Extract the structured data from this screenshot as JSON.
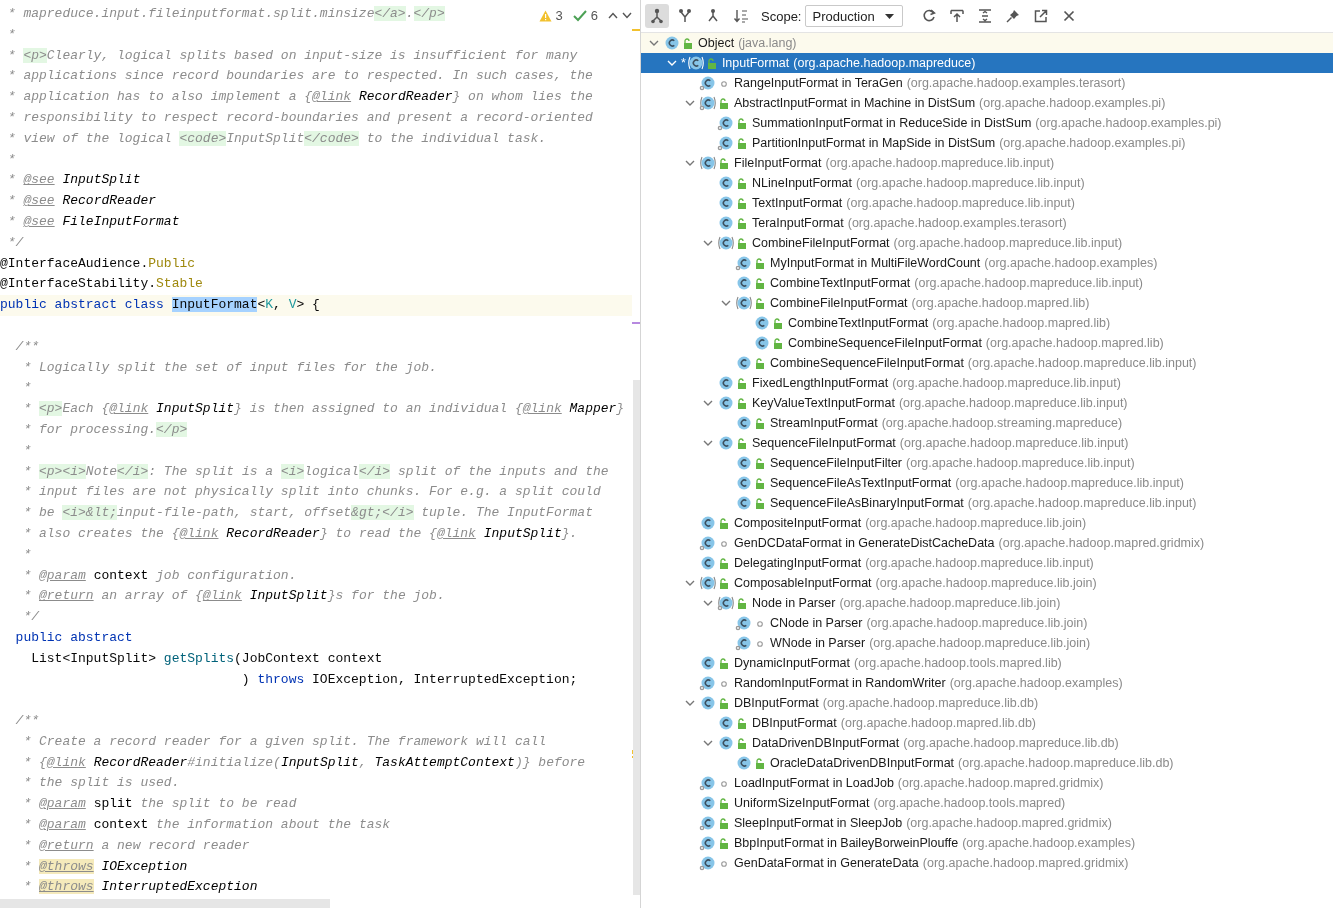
{
  "editor": {
    "inspections": {
      "warnings": "3",
      "checks": "6"
    },
    "lines": [
      {
        "kind": "code",
        "tokens": [
          {
            "kind": "c",
            "text": " * mapreduce.input.fileinputformat.split.minsize"
          },
          {
            "kind": "t",
            "text": "</a>"
          },
          {
            "kind": "c",
            "text": "."
          },
          {
            "kind": "t",
            "text": "</p>"
          }
        ]
      },
      {
        "kind": "code",
        "tokens": [
          {
            "kind": "c",
            "text": " *"
          }
        ]
      },
      {
        "kind": "code",
        "tokens": [
          {
            "kind": "c",
            "text": " * "
          },
          {
            "kind": "t",
            "text": "<p>"
          },
          {
            "kind": "c",
            "text": "Clearly, logical splits based on input-size is insufficient for many"
          }
        ]
      },
      {
        "kind": "code",
        "tokens": [
          {
            "kind": "c",
            "text": " * applications since record boundaries are to respected. In such cases, the"
          }
        ]
      },
      {
        "kind": "code",
        "tokens": [
          {
            "kind": "c",
            "text": " * application has to also implement a {"
          },
          {
            "kind": "d",
            "text": "@link"
          },
          {
            "kind": "r",
            "text": " RecordReader"
          },
          {
            "kind": "c",
            "text": "} on whom lies the"
          }
        ]
      },
      {
        "kind": "code",
        "tokens": [
          {
            "kind": "c",
            "text": " * responsibility to respect record-boundaries and present a record-oriented"
          }
        ]
      },
      {
        "kind": "code",
        "tokens": [
          {
            "kind": "c",
            "text": " * view of the logical "
          },
          {
            "kind": "t",
            "text": "<code>"
          },
          {
            "kind": "c",
            "text": "InputSplit"
          },
          {
            "kind": "t",
            "text": "</code>"
          },
          {
            "kind": "c",
            "text": " to the individual task."
          }
        ]
      },
      {
        "kind": "code",
        "tokens": [
          {
            "kind": "c",
            "text": " *"
          }
        ]
      },
      {
        "kind": "code",
        "tokens": [
          {
            "kind": "c",
            "text": " * "
          },
          {
            "kind": "d",
            "text": "@see"
          },
          {
            "kind": "r",
            "text": " InputSplit"
          }
        ]
      },
      {
        "kind": "code",
        "tokens": [
          {
            "kind": "c",
            "text": " * "
          },
          {
            "kind": "d",
            "text": "@see"
          },
          {
            "kind": "r",
            "text": " RecordReader"
          }
        ]
      },
      {
        "kind": "code",
        "tokens": [
          {
            "kind": "c",
            "text": " * "
          },
          {
            "kind": "d",
            "text": "@see"
          },
          {
            "kind": "r",
            "text": " FileInputFormat"
          }
        ]
      },
      {
        "kind": "code",
        "tokens": [
          {
            "kind": "c",
            "text": " */"
          }
        ]
      },
      {
        "kind": "code",
        "tokens": [
          {
            "kind": "p",
            "text": "@InterfaceAudience."
          },
          {
            "kind": "a",
            "text": "Public"
          }
        ]
      },
      {
        "kind": "code",
        "tokens": [
          {
            "kind": "p",
            "text": "@InterfaceStability."
          },
          {
            "kind": "a",
            "text": "Stable"
          }
        ]
      },
      {
        "kind": "current",
        "tokens": [
          {
            "kind": "k",
            "text": "public abstract class "
          },
          {
            "kind": "h",
            "text": "InputFormat"
          },
          {
            "kind": "p",
            "text": "<"
          },
          {
            "kind": "ty",
            "text": "K"
          },
          {
            "kind": "p",
            "text": ", "
          },
          {
            "kind": "ty",
            "text": "V"
          },
          {
            "kind": "p",
            "text": "> {"
          }
        ]
      },
      {
        "kind": "blank"
      },
      {
        "kind": "code",
        "tokens": [
          {
            "kind": "c",
            "text": "  /**"
          }
        ]
      },
      {
        "kind": "code",
        "tokens": [
          {
            "kind": "c",
            "text": "   * Logically split the set of input files for the job."
          }
        ]
      },
      {
        "kind": "code",
        "tokens": [
          {
            "kind": "c",
            "text": "   *"
          }
        ]
      },
      {
        "kind": "code",
        "tokens": [
          {
            "kind": "c",
            "text": "   * "
          },
          {
            "kind": "t",
            "text": "<p>"
          },
          {
            "kind": "c",
            "text": "Each {"
          },
          {
            "kind": "d",
            "text": "@link"
          },
          {
            "kind": "r",
            "text": " InputSplit"
          },
          {
            "kind": "c",
            "text": "} is then assigned to an individual {"
          },
          {
            "kind": "d",
            "text": "@link"
          },
          {
            "kind": "r",
            "text": " Mapper"
          },
          {
            "kind": "c",
            "text": "}"
          }
        ]
      },
      {
        "kind": "code",
        "tokens": [
          {
            "kind": "c",
            "text": "   * for processing."
          },
          {
            "kind": "t",
            "text": "</p>"
          }
        ]
      },
      {
        "kind": "code",
        "tokens": [
          {
            "kind": "c",
            "text": "   *"
          }
        ]
      },
      {
        "kind": "code",
        "tokens": [
          {
            "kind": "c",
            "text": "   * "
          },
          {
            "kind": "t",
            "text": "<p><i>"
          },
          {
            "kind": "c",
            "text": "Note"
          },
          {
            "kind": "t",
            "text": "</i>"
          },
          {
            "kind": "c",
            "text": ": The split is a "
          },
          {
            "kind": "t",
            "text": "<i>"
          },
          {
            "kind": "c",
            "text": "logical"
          },
          {
            "kind": "t",
            "text": "</i>"
          },
          {
            "kind": "c",
            "text": " split of the inputs and the"
          }
        ]
      },
      {
        "kind": "code",
        "tokens": [
          {
            "kind": "c",
            "text": "   * input files are not physically split into chunks. For e.g. a split could"
          }
        ]
      },
      {
        "kind": "code",
        "tokens": [
          {
            "kind": "c",
            "text": "   * be "
          },
          {
            "kind": "t",
            "text": "<i>&lt;"
          },
          {
            "kind": "c",
            "text": "input-file-path, start, offset"
          },
          {
            "kind": "t",
            "text": "&gt;</i>"
          },
          {
            "kind": "c",
            "text": " tuple. The InputFormat"
          }
        ]
      },
      {
        "kind": "code",
        "tokens": [
          {
            "kind": "c",
            "text": "   * also creates the {"
          },
          {
            "kind": "d",
            "text": "@link"
          },
          {
            "kind": "r",
            "text": " RecordReader"
          },
          {
            "kind": "c",
            "text": "} to read the {"
          },
          {
            "kind": "d",
            "text": "@link"
          },
          {
            "kind": "r",
            "text": " InputSplit"
          },
          {
            "kind": "c",
            "text": "}."
          }
        ]
      },
      {
        "kind": "code",
        "tokens": [
          {
            "kind": "c",
            "text": "   *"
          }
        ]
      },
      {
        "kind": "code",
        "tokens": [
          {
            "kind": "c",
            "text": "   * "
          },
          {
            "kind": "d",
            "text": "@param"
          },
          {
            "kind": "n",
            "text": " context"
          },
          {
            "kind": "c",
            "text": " job configuration."
          }
        ]
      },
      {
        "kind": "code",
        "tokens": [
          {
            "kind": "c",
            "text": "   * "
          },
          {
            "kind": "d",
            "text": "@return"
          },
          {
            "kind": "c",
            "text": " an array of {"
          },
          {
            "kind": "d",
            "text": "@link"
          },
          {
            "kind": "r",
            "text": " InputSplit"
          },
          {
            "kind": "c",
            "text": "}s for the job."
          }
        ]
      },
      {
        "kind": "code",
        "tokens": [
          {
            "kind": "c",
            "text": "   */"
          }
        ]
      },
      {
        "kind": "code",
        "tokens": [
          {
            "kind": "k",
            "text": "  public abstract"
          }
        ]
      },
      {
        "kind": "code",
        "tokens": [
          {
            "kind": "p",
            "text": "    List<InputSplit> "
          },
          {
            "kind": "m",
            "text": "getSplits"
          },
          {
            "kind": "p",
            "text": "(JobContext context"
          }
        ]
      },
      {
        "kind": "code",
        "tokens": [
          {
            "kind": "p",
            "text": "                               ) "
          },
          {
            "kind": "k",
            "text": "throws"
          },
          {
            "kind": "p",
            "text": " IOException, InterruptedException;"
          }
        ]
      },
      {
        "kind": "blank"
      },
      {
        "kind": "code",
        "tokens": [
          {
            "kind": "c",
            "text": "  /**"
          }
        ]
      },
      {
        "kind": "code",
        "tokens": [
          {
            "kind": "c",
            "text": "   * Create a record reader for a given split. The framework will call"
          }
        ]
      },
      {
        "kind": "code",
        "tokens": [
          {
            "kind": "c",
            "text": "   * {"
          },
          {
            "kind": "d",
            "text": "@link"
          },
          {
            "kind": "r",
            "text": " RecordReader"
          },
          {
            "kind": "c",
            "text": "#initialize("
          },
          {
            "kind": "r",
            "text": "InputSplit"
          },
          {
            "kind": "c",
            "text": ", "
          },
          {
            "kind": "r",
            "text": "TaskAttemptContext"
          },
          {
            "kind": "c",
            "text": ")} before"
          }
        ]
      },
      {
        "kind": "code",
        "tokens": [
          {
            "kind": "c",
            "text": "   * the split is used."
          }
        ]
      },
      {
        "kind": "code",
        "tokens": [
          {
            "kind": "c",
            "text": "   * "
          },
          {
            "kind": "d",
            "text": "@param"
          },
          {
            "kind": "n",
            "text": " split"
          },
          {
            "kind": "c",
            "text": " the split to be read"
          }
        ]
      },
      {
        "kind": "code",
        "tokens": [
          {
            "kind": "c",
            "text": "   * "
          },
          {
            "kind": "d",
            "text": "@param"
          },
          {
            "kind": "n",
            "text": " context"
          },
          {
            "kind": "c",
            "text": " the information about the task"
          }
        ]
      },
      {
        "kind": "code",
        "tokens": [
          {
            "kind": "c",
            "text": "   * "
          },
          {
            "kind": "d",
            "text": "@return"
          },
          {
            "kind": "c",
            "text": " a new record reader"
          }
        ]
      },
      {
        "kind": "code",
        "tokens": [
          {
            "kind": "c",
            "text": "   * "
          },
          {
            "kind": "dh",
            "text": "@throws"
          },
          {
            "kind": "r",
            "text": " IOException"
          }
        ]
      },
      {
        "kind": "code",
        "tokens": [
          {
            "kind": "c",
            "text": "   * "
          },
          {
            "kind": "dh",
            "text": "@throws"
          },
          {
            "kind": "r",
            "text": " InterruptedException"
          }
        ]
      }
    ]
  },
  "toolbar": {
    "modes": [
      {
        "kind": "hierarchy",
        "selected": true
      },
      {
        "kind": "supertypes",
        "selected": false
      },
      {
        "kind": "subtypes",
        "selected": false
      },
      {
        "kind": "sort",
        "selected": false
      }
    ],
    "scope_label": "Scope:",
    "scope": "Production",
    "actions": [
      {
        "kind": "refresh"
      },
      {
        "kind": "export"
      },
      {
        "kind": "expand"
      },
      {
        "kind": "pin"
      },
      {
        "kind": "open"
      },
      {
        "kind": "close"
      }
    ]
  },
  "tree": [
    {
      "name": "Object",
      "package": "(java.lang)",
      "abstract": false,
      "public": true,
      "nested": false,
      "selected": false,
      "expanded": true,
      "children": [
        {
          "name": "InputFormat",
          "package": "(org.apache.hadoop.mapreduce)",
          "marker": "*",
          "abstract": true,
          "public": true,
          "nested": false,
          "selected": true,
          "expanded": true,
          "children": [
            {
              "name": "RangeInputFormat in TeraGen",
              "package": "(org.apache.hadoop.examples.terasort)",
              "abstract": false,
              "public": false,
              "nested": true,
              "selected": false
            },
            {
              "name": "AbstractInputFormat in Machine in DistSum",
              "package": "(org.apache.hadoop.examples.pi)",
              "abstract": true,
              "public": true,
              "nested": true,
              "selected": false,
              "expanded": true,
              "children": [
                {
                  "name": "SummationInputFormat in ReduceSide in DistSum",
                  "package": "(org.apache.hadoop.examples.pi)",
                  "abstract": false,
                  "public": true,
                  "nested": true,
                  "selected": false
                },
                {
                  "name": "PartitionInputFormat in MapSide in DistSum",
                  "package": "(org.apache.hadoop.examples.pi)",
                  "abstract": false,
                  "public": true,
                  "nested": true,
                  "selected": false
                }
              ]
            },
            {
              "name": "FileInputFormat",
              "package": "(org.apache.hadoop.mapreduce.lib.input)",
              "abstract": true,
              "public": true,
              "nested": false,
              "selected": false,
              "expanded": true,
              "children": [
                {
                  "name": "NLineInputFormat",
                  "package": "(org.apache.hadoop.mapreduce.lib.input)",
                  "abstract": false,
                  "public": true,
                  "nested": false,
                  "selected": false
                },
                {
                  "name": "TextInputFormat",
                  "package": "(org.apache.hadoop.mapreduce.lib.input)",
                  "abstract": false,
                  "public": true,
                  "nested": false,
                  "selected": false
                },
                {
                  "name": "TeraInputFormat",
                  "package": "(org.apache.hadoop.examples.terasort)",
                  "abstract": false,
                  "public": true,
                  "nested": false,
                  "selected": false
                },
                {
                  "name": "CombineFileInputFormat",
                  "package": "(org.apache.hadoop.mapreduce.lib.input)",
                  "abstract": true,
                  "public": true,
                  "nested": false,
                  "selected": false,
                  "expanded": true,
                  "children": [
                    {
                      "name": "MyInputFormat in MultiFileWordCount",
                      "package": "(org.apache.hadoop.examples)",
                      "abstract": false,
                      "public": true,
                      "nested": true,
                      "selected": false
                    },
                    {
                      "name": "CombineTextInputFormat",
                      "package": "(org.apache.hadoop.mapreduce.lib.input)",
                      "abstract": false,
                      "public": true,
                      "nested": false,
                      "selected": false
                    },
                    {
                      "name": "CombineFileInputFormat",
                      "package": "(org.apache.hadoop.mapred.lib)",
                      "abstract": true,
                      "public": true,
                      "nested": false,
                      "selected": false,
                      "expanded": true,
                      "children": [
                        {
                          "name": "CombineTextInputFormat",
                          "package": "(org.apache.hadoop.mapred.lib)",
                          "abstract": false,
                          "public": true,
                          "nested": false,
                          "selected": false
                        },
                        {
                          "name": "CombineSequenceFileInputFormat",
                          "package": "(org.apache.hadoop.mapred.lib)",
                          "abstract": false,
                          "public": true,
                          "nested": false,
                          "selected": false
                        }
                      ]
                    },
                    {
                      "name": "CombineSequenceFileInputFormat",
                      "package": "(org.apache.hadoop.mapreduce.lib.input)",
                      "abstract": false,
                      "public": true,
                      "nested": false,
                      "selected": false
                    }
                  ]
                },
                {
                  "name": "FixedLengthInputFormat",
                  "package": "(org.apache.hadoop.mapreduce.lib.input)",
                  "abstract": false,
                  "public": true,
                  "nested": false,
                  "selected": false
                },
                {
                  "name": "KeyValueTextInputFormat",
                  "package": "(org.apache.hadoop.mapreduce.lib.input)",
                  "abstract": false,
                  "public": true,
                  "nested": false,
                  "selected": false,
                  "expanded": true,
                  "children": [
                    {
                      "name": "StreamInputFormat",
                      "package": "(org.apache.hadoop.streaming.mapreduce)",
                      "abstract": false,
                      "public": true,
                      "nested": false,
                      "selected": false
                    }
                  ]
                },
                {
                  "name": "SequenceFileInputFormat",
                  "package": "(org.apache.hadoop.mapreduce.lib.input)",
                  "abstract": false,
                  "public": true,
                  "nested": false,
                  "selected": false,
                  "expanded": true,
                  "children": [
                    {
                      "name": "SequenceFileInputFilter",
                      "package": "(org.apache.hadoop.mapreduce.lib.input)",
                      "abstract": false,
                      "public": true,
                      "nested": false,
                      "selected": false
                    },
                    {
                      "name": "SequenceFileAsTextInputFormat",
                      "package": "(org.apache.hadoop.mapreduce.lib.input)",
                      "abstract": false,
                      "public": true,
                      "nested": false,
                      "selected": false
                    },
                    {
                      "name": "SequenceFileAsBinaryInputFormat",
                      "package": "(org.apache.hadoop.mapreduce.lib.input)",
                      "abstract": false,
                      "public": true,
                      "nested": false,
                      "selected": false
                    }
                  ]
                }
              ]
            },
            {
              "name": "CompositeInputFormat",
              "package": "(org.apache.hadoop.mapreduce.lib.join)",
              "abstract": false,
              "public": true,
              "nested": false,
              "selected": false
            },
            {
              "name": "GenDCDataFormat in GenerateDistCacheData",
              "package": "(org.apache.hadoop.mapred.gridmix)",
              "abstract": false,
              "public": false,
              "nested": true,
              "selected": false
            },
            {
              "name": "DelegatingInputFormat",
              "package": "(org.apache.hadoop.mapreduce.lib.input)",
              "abstract": false,
              "public": true,
              "nested": false,
              "selected": false
            },
            {
              "name": "ComposableInputFormat",
              "package": "(org.apache.hadoop.mapreduce.lib.join)",
              "abstract": true,
              "public": true,
              "nested": false,
              "selected": false,
              "expanded": true,
              "children": [
                {
                  "name": "Node in Parser",
                  "package": "(org.apache.hadoop.mapreduce.lib.join)",
                  "abstract": true,
                  "public": true,
                  "nested": true,
                  "selected": false,
                  "expanded": true,
                  "children": [
                    {
                      "name": "CNode in Parser",
                      "package": "(org.apache.hadoop.mapreduce.lib.join)",
                      "abstract": false,
                      "public": false,
                      "nested": true,
                      "selected": false
                    },
                    {
                      "name": "WNode in Parser",
                      "package": "(org.apache.hadoop.mapreduce.lib.join)",
                      "abstract": false,
                      "public": false,
                      "nested": true,
                      "selected": false
                    }
                  ]
                }
              ]
            },
            {
              "name": "DynamicInputFormat",
              "package": "(org.apache.hadoop.tools.mapred.lib)",
              "abstract": false,
              "public": true,
              "nested": false,
              "selected": false
            },
            {
              "name": "RandomInputFormat in RandomWriter",
              "package": "(org.apache.hadoop.examples)",
              "abstract": false,
              "public": false,
              "nested": true,
              "selected": false
            },
            {
              "name": "DBInputFormat",
              "package": "(org.apache.hadoop.mapreduce.lib.db)",
              "abstract": false,
              "public": true,
              "nested": false,
              "selected": false,
              "expanded": true,
              "children": [
                {
                  "name": "DBInputFormat",
                  "package": "(org.apache.hadoop.mapred.lib.db)",
                  "abstract": false,
                  "public": true,
                  "nested": false,
                  "selected": false
                },
                {
                  "name": "DataDrivenDBInputFormat",
                  "package": "(org.apache.hadoop.mapreduce.lib.db)",
                  "abstract": false,
                  "public": true,
                  "nested": false,
                  "selected": false,
                  "expanded": true,
                  "children": [
                    {
                      "name": "OracleDataDrivenDBInputFormat",
                      "package": "(org.apache.hadoop.mapreduce.lib.db)",
                      "abstract": false,
                      "public": true,
                      "nested": false,
                      "selected": false
                    }
                  ]
                }
              ]
            },
            {
              "name": "LoadInputFormat in LoadJob",
              "package": "(org.apache.hadoop.mapred.gridmix)",
              "abstract": false,
              "public": false,
              "nested": true,
              "selected": false
            },
            {
              "name": "UniformSizeInputFormat",
              "package": "(org.apache.hadoop.tools.mapred)",
              "abstract": false,
              "public": true,
              "nested": false,
              "selected": false
            },
            {
              "name": "SleepInputFormat in SleepJob",
              "package": "(org.apache.hadoop.mapred.gridmix)",
              "abstract": false,
              "public": true,
              "nested": true,
              "selected": false
            },
            {
              "name": "BbpInputFormat in BaileyBorweinPlouffe",
              "package": "(org.apache.hadoop.examples)",
              "abstract": false,
              "public": true,
              "nested": true,
              "selected": false
            },
            {
              "name": "GenDataFormat in GenerateData",
              "package": "(org.apache.hadoop.mapred.gridmix)",
              "abstract": false,
              "public": false,
              "nested": true,
              "selected": false
            }
          ]
        }
      ]
    }
  ]
}
